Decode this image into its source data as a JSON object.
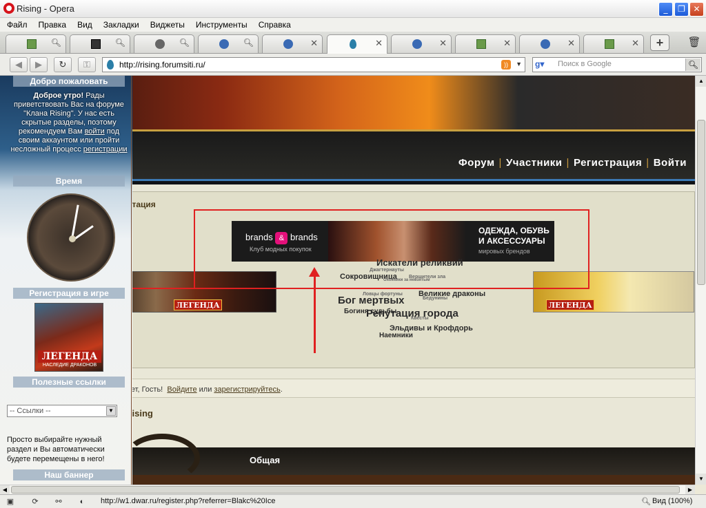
{
  "window": {
    "title": "Rising - Opera"
  },
  "menu": [
    "Файл",
    "Правка",
    "Вид",
    "Закладки",
    "Виджеты",
    "Инструменты",
    "Справка"
  ],
  "address": {
    "url": "http://rising.forumsiti.ru/",
    "search_placeholder": "Поиск в Google"
  },
  "sidebar": {
    "welcome_head": "Добро пожаловать",
    "welcome_bold": "Доброе утро!",
    "welcome_text": " Рады приветствовать Вас на форуме \"Клана Rising\". У нас есть скрытые разделы, поэтому рекомендуем Вам ",
    "welcome_link1": "войти",
    "welcome_text2": " под своим аккаунтом или пройти несложный процесс ",
    "welcome_link2": "регистрации",
    "time_head": "Время",
    "reg_head": "Регистрация в игре",
    "game_logo": "ЛЕГЕНДА",
    "game_sub": "НАСЛЕДИЕ ДРАКОНОВ",
    "links_head": "Полезные ссылки",
    "links_select": "-- Ссылки --",
    "links_text": "Просто выбирайте нужный раздел и Вы автоматически будете перемещены в него!",
    "banner_head": "Наш баннер"
  },
  "nav": [
    "Форум",
    "Участники",
    "Регистрация",
    "Войти"
  ],
  "reputation": {
    "title": "Репутация",
    "cloud": [
      "Искатели реликвий",
      "Сокровищница",
      "Джагтернауты",
      "Вершители зла",
      "Охотники за невзятым",
      "Бог мертвых",
      "Великие драконы",
      "Ловцы фортуны",
      "Богиня судьбы",
      "Бедунины",
      "Репутация города",
      "Квесты",
      "Эльдивы и Крофдорь",
      "Наемники"
    ]
  },
  "ad": {
    "brand_left": "brands",
    "brand_amp": "&",
    "brand_right": "brands",
    "brand_sub": "Клуб модных покупок",
    "right_line1": "ОДЕЖДА, ОБУВЬ",
    "right_line2": "И АКСЕССУАРЫ",
    "right_sub": "мировых брендов"
  },
  "banners": {
    "left_logo": "ЛЕГЕНДА",
    "right_logo": "ЛЕГЕНДА"
  },
  "guest": {
    "prefix": "Привет, Гость!",
    "login": "Войдите",
    "or": "или",
    "register": "зарегистрируйтесь",
    "suffix": "."
  },
  "forum": {
    "section": "Rising",
    "category": "Общая"
  },
  "status": {
    "url": "http://w1.dwar.ru/register.php?referrer=Blakc%20Ice",
    "zoom": "Вид (100%)"
  },
  "colors": {
    "accent_red": "#e02020",
    "opera_red": "#d6131b"
  }
}
